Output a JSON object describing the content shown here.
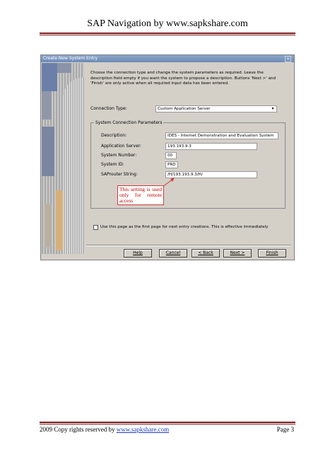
{
  "header": {
    "title": "SAP Navigation by www.sapkshare.com"
  },
  "dialog": {
    "title": "Create New System Entry",
    "description": "Choose the connection type and change the system parameters as required. Leave the description field empty if you want the system to propose a description. Buttons 'Next >' and 'Finish' are only active when all required input data has been entered.",
    "connection_type_label": "Connection Type:",
    "connection_type_value": "Custom Application Server",
    "group_title": "System Connection Parameters",
    "fields": [
      {
        "label": "Description:",
        "value": "IDES - Internet Demonstration and Evaluation System"
      },
      {
        "label": "Application Server:",
        "value": "193.193.9.3"
      },
      {
        "label": "System Number:",
        "value": "00"
      },
      {
        "label": "System ID:",
        "value": "PRD"
      },
      {
        "label": "SAProuter String:",
        "value": "/H/193.193.9.3/H/"
      }
    ],
    "annotation": "This setting is used only for remote access",
    "checkbox_label": "Use this page as the first page for next entry creations. This is effective immediately",
    "buttons": {
      "help": "Help",
      "cancel": "Cancel",
      "back": "< Back",
      "next": "Next >",
      "finish": "Finish"
    }
  },
  "footer": {
    "copyright": "2009 Copy rights reserved by ",
    "link_text": "www.sapkshare.com",
    "page": "Page 3"
  },
  "colors": {
    "rule": "#7a1a1a",
    "callout": "#c00000",
    "titlebar": "#7d97c0"
  }
}
